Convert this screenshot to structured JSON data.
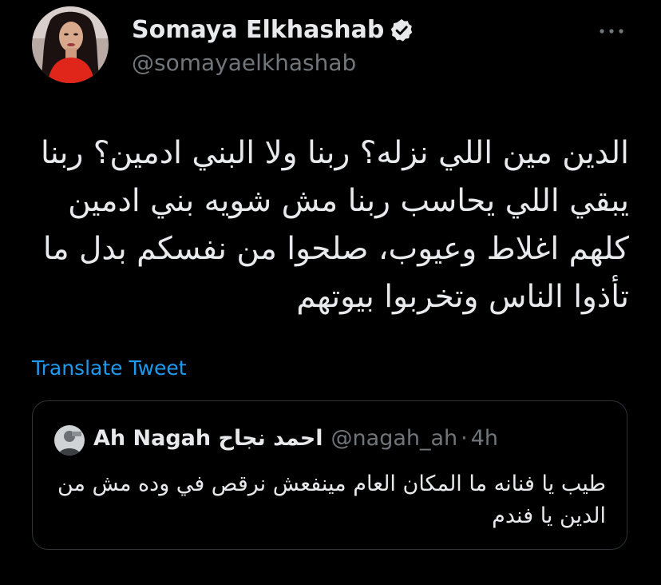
{
  "author": {
    "display_name": "Somaya Elkhashab",
    "handle": "@somayaelkhashab",
    "verified": true,
    "avatar_icon": "profile-photo"
  },
  "tweet": {
    "text": "الدين مين اللي نزله؟ ربنا ولا البني ادمين؟ ربنا يبقي اللي يحاسب ربنا مش شويه بني ادمين كلهم اغلاط وعيوب، صلحوا من نفسكم بدل ما تأذوا الناس وتخربوا بيوتهم",
    "translate_label": "Translate Tweet",
    "more_icon": "more-icon"
  },
  "quoted": {
    "display_name": "Ah Nagah احمد نجاح",
    "handle": "@nagah_ah",
    "separator": "·",
    "time": "4h",
    "text": "طيب يا فنانه ما المكان العام مينفعش نرقص في وده مش من الدين يا فندم"
  },
  "colors": {
    "background": "#000000",
    "primary_text": "#e7e9ea",
    "secondary_text": "#71767b",
    "accent": "#1d9bf0",
    "border": "#2f3336"
  }
}
